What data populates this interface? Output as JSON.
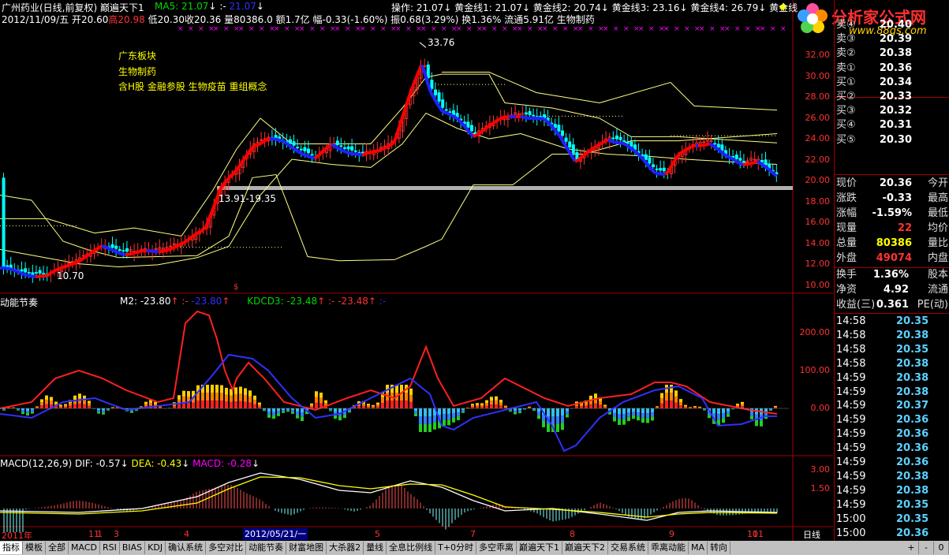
{
  "header": {
    "stock": "广州药业(日线,前复权)",
    "indicator_name": "巅遍天下1",
    "ma5_label": "MA5: 21.07",
    "ma5_arrow": "↓",
    "ma_extra1": ":-",
    "ma_extra2": "21.07",
    "ma_extra2_arrow": "↓",
    "op_label": "操作: 21.07",
    "op_arrow": "↓",
    "gold1": "黄金线1: 21.07",
    "gold1_arrow": "↓",
    "gold2": "黄金线2: 20.74",
    "gold2_arrow": "↓",
    "gold3": "黄金线3: 23.16",
    "gold3_arrow": "↓",
    "gold4": "黄金线4: 26.79",
    "gold4_arrow": "↓",
    "gold5": "黄金线",
    "nav_diamond": "◆"
  },
  "info_line": {
    "date": "2012/11/09/五",
    "open": "开20.60",
    "high": "高20.98",
    "low": "低20.30",
    "close": "收20.36",
    "vol": "量80386.0",
    "amount": "额1.7亿",
    "change": "幅-0.33(-1.60%)",
    "amp": "振0.68(3.29%)",
    "turnover": "换1.36%",
    "float": "流通5.91亿",
    "sector": "生物制药"
  },
  "annotations": {
    "region": "广东板块",
    "industry": "生物制药",
    "concepts": "含H股 金融参股 生物疫苗 重组概念",
    "peak": "33.76",
    "range": "13.91-19.35",
    "low_price": "10.70",
    "dollar": "$"
  },
  "price_axis": [
    "32.00",
    "30.00",
    "28.00",
    "26.00",
    "24.00",
    "22.00",
    "20.00",
    "18.00",
    "16.00",
    "14.00",
    "12.00",
    "10.00"
  ],
  "panel2": {
    "title": "动能节奏",
    "m2": "M2: -23.80",
    "m2_arrow": "↑",
    "m2_b": ":-",
    "m2_c": "-23.80",
    "m2_c_arrow": "↑",
    "kdcd3": "KDCD3: -23.48",
    "kdcd3_arrow": "↑",
    "kd_b": ":-",
    "kd_c": "-23.48",
    "kd_c_arrow": "↑",
    "kd_d": ":-",
    "axis": [
      "200.00",
      "100.00",
      "0.00"
    ]
  },
  "panel3": {
    "title": "MACD(12,26,9)",
    "dif": "DIF: -0.57",
    "dif_arrow": "↓",
    "dea": "DEA: -0.43",
    "dea_arrow": "↓",
    "macd": "MACD: -0.28",
    "macd_arrow": "↓",
    "axis": [
      "3.00",
      "1.50"
    ]
  },
  "date_axis": {
    "labels": [
      "2011年",
      "11",
      "1",
      "3",
      "4",
      "5",
      "7",
      "8",
      "9",
      "10",
      "11"
    ],
    "cursor_date": "2012/05/21/一",
    "period": "日线"
  },
  "logo": {
    "title": "分析家公式网",
    "url": "www.88gs.com"
  },
  "order_book": [
    {
      "label": "卖④",
      "price": "20.40"
    },
    {
      "label": "卖③",
      "price": "20.39"
    },
    {
      "label": "卖②",
      "price": "20.38"
    },
    {
      "label": "卖①",
      "price": "20.36"
    },
    {
      "label": "买①",
      "price": "20.34"
    },
    {
      "label": "买②",
      "price": "20.33"
    },
    {
      "label": "买③",
      "price": "20.32"
    },
    {
      "label": "买④",
      "price": "20.31"
    },
    {
      "label": "买⑤",
      "price": "20.30"
    }
  ],
  "stats": [
    {
      "l": "现价",
      "v": "20.36",
      "r": "今开",
      "color": "#ffffff"
    },
    {
      "l": "涨跌",
      "v": "-0.33",
      "r": "最高",
      "color": "#ffffff"
    },
    {
      "l": "涨幅",
      "v": "-1.59%",
      "r": "最低",
      "color": "#ffffff"
    },
    {
      "l": "现量",
      "v": "22",
      "r": "均价",
      "color": "#ff3232"
    },
    {
      "l": "总量",
      "v": "80386",
      "r": "量比",
      "color": "#ffff00"
    },
    {
      "l": "外盘",
      "v": "49074",
      "r": "内盘",
      "color": "#ff3232"
    }
  ],
  "stats2": [
    {
      "l": "换手",
      "v": "1.36%",
      "r": "股本"
    },
    {
      "l": "净资",
      "v": "4.92",
      "r": "流通"
    },
    {
      "l": "收益(三)",
      "v": "0.361",
      "r": "PE(动)"
    }
  ],
  "ticks": [
    {
      "t": "14:58",
      "p": "20.35"
    },
    {
      "t": "14:58",
      "p": "20.38"
    },
    {
      "t": "14:58",
      "p": "20.35"
    },
    {
      "t": "14:58",
      "p": "20.38"
    },
    {
      "t": "14:59",
      "p": "20.38"
    },
    {
      "t": "14:59",
      "p": "20.38"
    },
    {
      "t": "14:59",
      "p": "20.37"
    },
    {
      "t": "14:59",
      "p": "20.36"
    },
    {
      "t": "14:59",
      "p": "20.36"
    },
    {
      "t": "14:59",
      "p": "20.36"
    },
    {
      "t": "14:59",
      "p": "20.36"
    },
    {
      "t": "14:59",
      "p": "20.38"
    },
    {
      "t": "14:59",
      "p": "20.38"
    },
    {
      "t": "14:59",
      "p": "20.35"
    },
    {
      "t": "15:00",
      "p": "20.35"
    },
    {
      "t": "15:00",
      "p": "20.36"
    }
  ],
  "tabs": [
    "指标",
    "模板",
    "全部",
    "MACD",
    "RSI",
    "BIAS",
    "KDJ",
    "确认系统",
    "多空对比",
    "动能节奏",
    "财富地图",
    "大杀器2",
    "量线",
    "全息比例线",
    "T+0分时",
    "多空乖离",
    "巅遍天下1",
    "巅遍天下2",
    "交易系统",
    "乖离动能",
    "MA",
    "转向"
  ],
  "tab_controls": [
    "+",
    "-",
    "0"
  ],
  "colors": {
    "up": "#ff3232",
    "down": "#00ffff",
    "ma_red": "#ff0000",
    "ma_blue": "#2020ff",
    "gold": "#ffff80",
    "grid": "#a00000"
  }
}
